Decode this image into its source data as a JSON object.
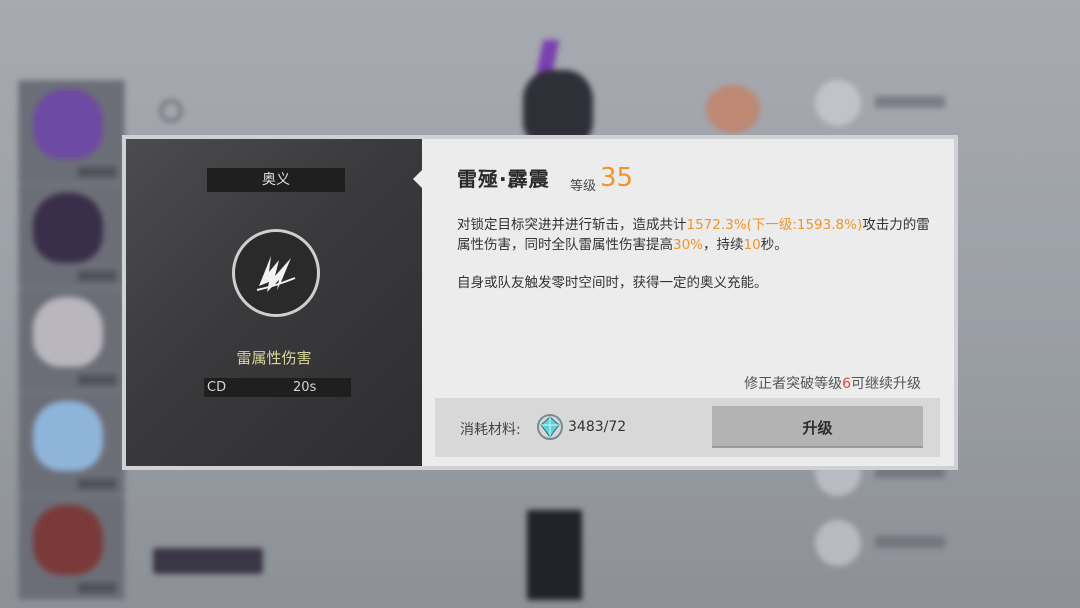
{
  "modal": {
    "section_tag": "奥义",
    "skill_icon": "lightning-slash-icon",
    "element_label": "雷属性伤害",
    "cd_label": "CD",
    "cd_value": "20s",
    "skill_name": "雷殛·霹震",
    "level_label": "等级",
    "level_value": "35",
    "description": {
      "part1": "对锁定目标突进并进行斩击，造成共计",
      "hl1": "1572.3%(下一级:1593.8%)",
      "part2": "攻击力的雷属性伤害，同时全队雷属性伤害提高",
      "hl2": "30%",
      "part3": "，持续",
      "hl3": "10",
      "part4": "秒。"
    },
    "description2": "自身或队友触发零时空间时，获得一定的奥义充能。",
    "requirement": {
      "before": "修正者突破等级",
      "level": "6",
      "after": "可继续升级"
    },
    "material_label": "消耗材料:",
    "material_icon": "crystal-material-icon",
    "material_count": "3483/72",
    "upgrade_label": "升级"
  },
  "colors": {
    "highlight": "#f0952d",
    "requirement_level": "#e2453b",
    "element_label": "#d7d89a"
  }
}
